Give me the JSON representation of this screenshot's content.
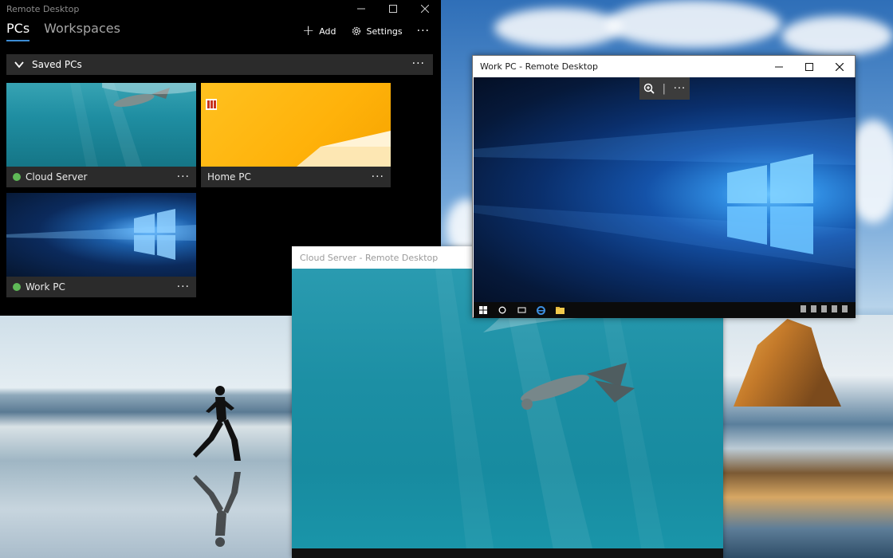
{
  "main_app": {
    "title": "Remote Desktop",
    "tabs": [
      {
        "label": "PCs",
        "active": true
      },
      {
        "label": "Workspaces",
        "active": false
      }
    ],
    "actions": {
      "add_label": "Add",
      "settings_label": "Settings"
    },
    "section": {
      "label": "Saved PCs"
    },
    "pcs": [
      {
        "name": "Cloud Server",
        "connected": true,
        "thumbnail": "underwater-swimmer"
      },
      {
        "name": "Home PC",
        "connected": false,
        "thumbnail": "yellow-windows8"
      },
      {
        "name": "Work PC",
        "connected": true,
        "thumbnail": "windows10-hero"
      }
    ]
  },
  "cloud_window": {
    "title": "Cloud Server - Remote Desktop"
  },
  "work_window": {
    "title": "Work PC - Remote Desktop"
  },
  "colors": {
    "accent": "#3c8cd4",
    "status_online": "#5fba57",
    "tile_bg": "#2b2b2b",
    "app_bg": "#000000"
  }
}
